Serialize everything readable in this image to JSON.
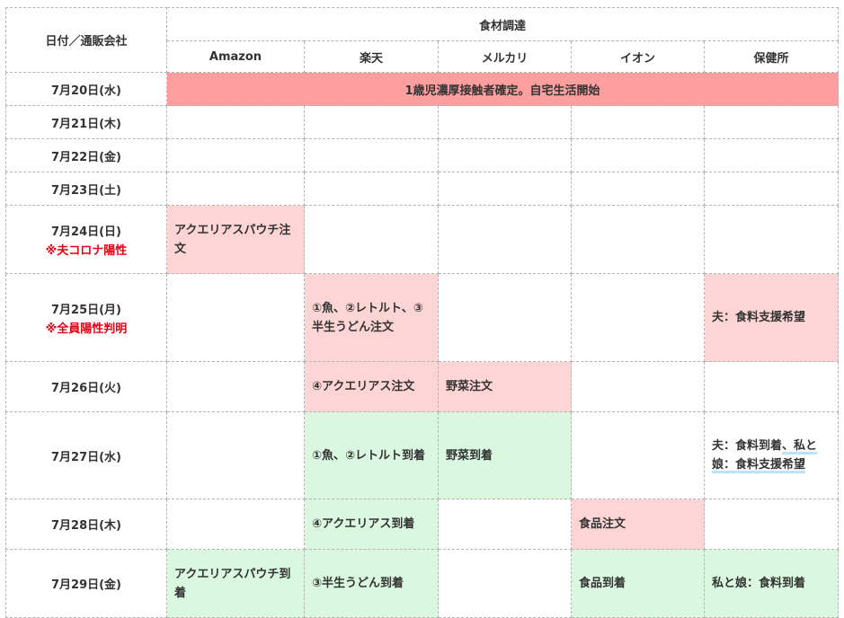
{
  "header": {
    "date_col": "日付／通販会社",
    "group": "食材調達",
    "vendors": [
      "Amazon",
      "楽天",
      "メルカリ",
      "イオン",
      "保健所"
    ]
  },
  "rows": [
    {
      "date": "7月20日(水)",
      "banner": "1歳児濃厚接触者確定。自宅生活開始"
    },
    {
      "date": "7月21日(木)"
    },
    {
      "date": "7月22日(金)"
    },
    {
      "date": "7月23日(土)"
    },
    {
      "date": "7月24日(日)",
      "note": "※夫コロナ陽性",
      "cells": {
        "amazon": "アクエリアスパウチ注文"
      }
    },
    {
      "date": "7月25日(月)",
      "note": "※全員陽性判明",
      "cells": {
        "rakuten": "①魚、②レトルト、③半生うどん注文",
        "hokenjo": "夫：食料支援希望"
      }
    },
    {
      "date": "7月26日(火)",
      "cells": {
        "rakuten": "④アクエリアス注文",
        "mercari": "野菜注文"
      }
    },
    {
      "date": "7月27日(水)",
      "cells": {
        "rakuten": "①魚、②レトルト到着",
        "mercari": "野菜到着",
        "hokenjo_1": "夫：食料到着",
        "hokenjo_2": "、私と娘：食料支援希望"
      }
    },
    {
      "date": "7月28日(木)",
      "cells": {
        "rakuten": "④アクエリアス到着",
        "aeon": "食品注文"
      }
    },
    {
      "date": "7月29日(金)",
      "cells": {
        "amazon": "アクエリアスパウチ到着",
        "rakuten": "③半生うどん到着",
        "aeon": "食品到着",
        "hokenjo": "私と娘：食料到着"
      }
    }
  ],
  "colors": {
    "order": "#fdd5d5",
    "arrival": "#d9f8df",
    "banner": "#ff9e9e",
    "note": "#e60012"
  }
}
